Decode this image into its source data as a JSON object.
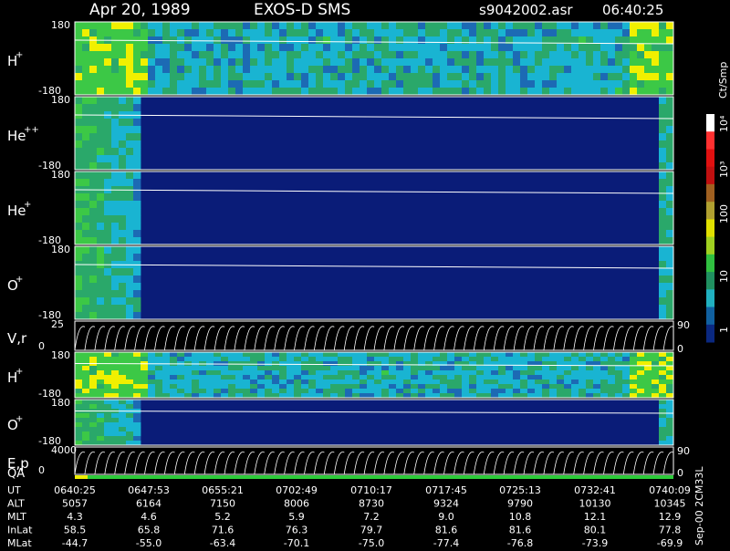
{
  "header": {
    "date": "Apr 20, 1989",
    "instrument": "EXOS-D SMS",
    "file": "s9042002.asr",
    "time": "06:40:25"
  },
  "chart_data": {
    "type": "heatmap",
    "panels": [
      {
        "label": "H",
        "sup": "+",
        "ymax": "180",
        "ymin": "-180",
        "kind": "spectrogram"
      },
      {
        "label": "He",
        "sup": "++",
        "ymax": "180",
        "ymin": "-180",
        "kind": "spectrogram"
      },
      {
        "label": "He",
        "sup": "+",
        "ymax": "180",
        "ymin": "-180",
        "kind": "spectrogram"
      },
      {
        "label": "O",
        "sup": "+",
        "ymax": "180",
        "ymin": "-180",
        "kind": "spectrogram"
      },
      {
        "label": "V,r",
        "sup": "",
        "ymax": "25",
        "ymin": "0",
        "right_top": "90",
        "right_bottom": "0",
        "kind": "lines"
      },
      {
        "label": "H",
        "sup": "+",
        "ymax": "180",
        "ymin": "-180",
        "kind": "spectrogram"
      },
      {
        "label": "O",
        "sup": "+",
        "ymax": "180",
        "ymin": "-180",
        "kind": "spectrogram"
      },
      {
        "label": "E,p",
        "sup": "",
        "ymax": "4000",
        "ymin": "0",
        "right_top": "90",
        "right_bottom": "0",
        "kind": "lines"
      }
    ],
    "qa_label": "QA",
    "colorbar": {
      "unit": "Ct/Smp",
      "ticks": [
        "10⁴",
        "10³",
        "100",
        "10",
        "1"
      ]
    },
    "table": {
      "rows": [
        {
          "name": "UT",
          "values": [
            "0640:25",
            "0647:53",
            "0655:21",
            "0702:49",
            "0710:17",
            "0717:45",
            "0725:13",
            "0732:41",
            "0740:09"
          ]
        },
        {
          "name": "ALT",
          "values": [
            "5057",
            "6164",
            "7150",
            "8006",
            "8730",
            "9324",
            "9790",
            "10130",
            "10345"
          ]
        },
        {
          "name": "MLT",
          "values": [
            "4.3",
            "4.6",
            "5.2",
            "5.9",
            "7.2",
            "9.0",
            "10.8",
            "12.1",
            "12.9"
          ]
        },
        {
          "name": "InLat",
          "values": [
            "58.5",
            "65.8",
            "71.6",
            "76.3",
            "79.7",
            "81.6",
            "81.6",
            "80.1",
            "77.8"
          ]
        },
        {
          "name": "MLat",
          "values": [
            "-44.7",
            "-55.0",
            "-63.4",
            "-70.1",
            "-75.0",
            "-77.4",
            "-76.8",
            "-73.9",
            "-69.9"
          ]
        }
      ]
    },
    "footer_note": "Sep-00 2CM33L"
  },
  "colors": {
    "background": "#000000",
    "low": "#0a1c78",
    "cyan": "#19b4d2",
    "green": "#3cc846",
    "yellow": "#f0f000",
    "red": "#e61e1e"
  }
}
